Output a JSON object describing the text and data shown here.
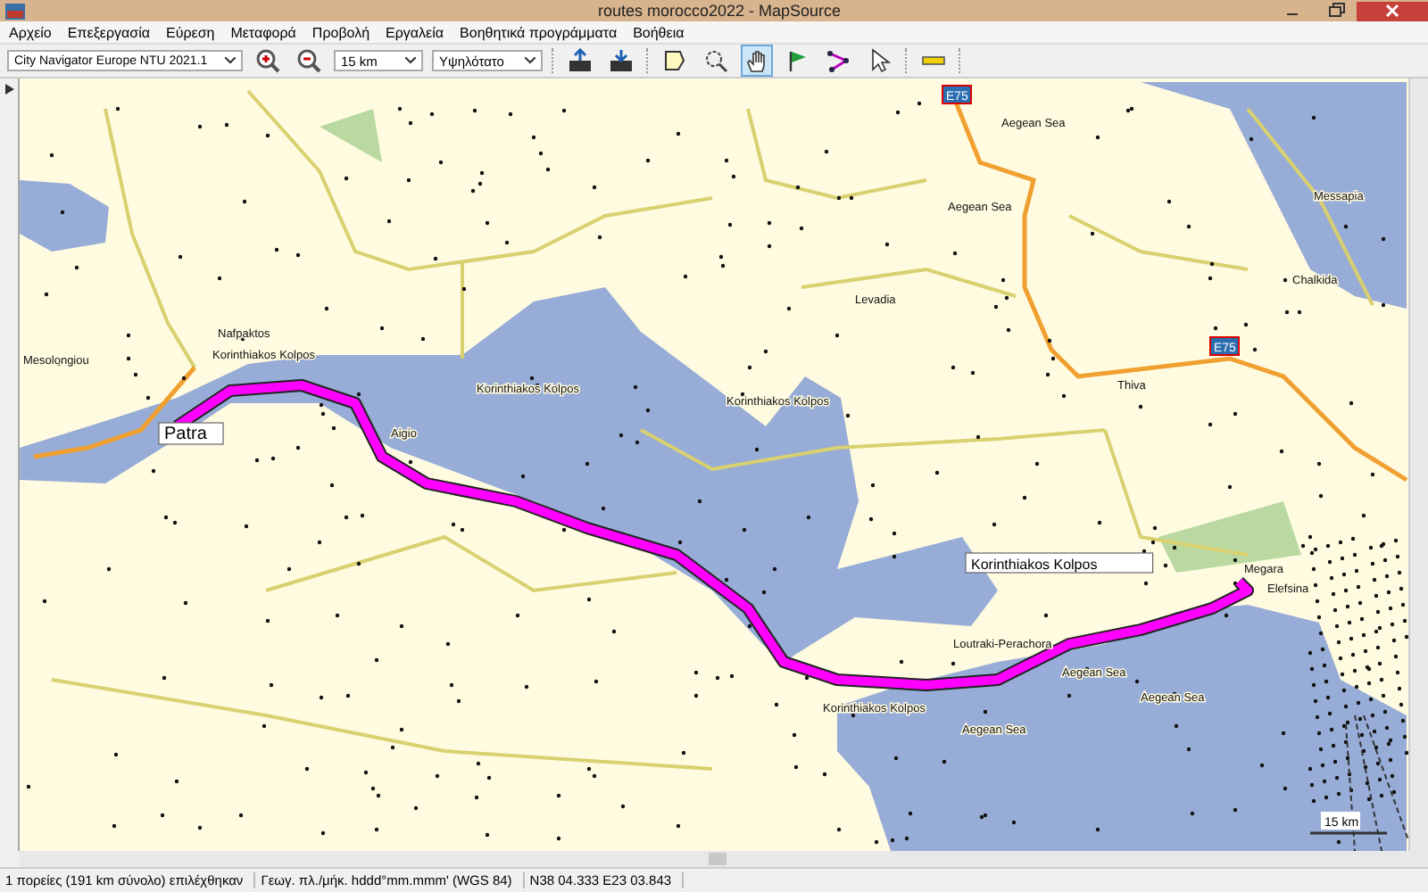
{
  "window": {
    "title": "routes morocco2022 - MapSource"
  },
  "menu": [
    "Αρχείο",
    "Επεξεργασία",
    "Εύρεση",
    "Μεταφορά",
    "Προβολή",
    "Εργαλεία",
    "Βοηθητικά προγράμματα",
    "Βοήθεια"
  ],
  "toolbar": {
    "map_select": "City Navigator Europe NTU 2021.1",
    "zoom_select": "15 km",
    "detail_select": "Υψηλότατο",
    "tools": [
      {
        "kind": "zoom-in",
        "selected": false
      },
      {
        "kind": "zoom-out",
        "selected": false
      },
      {
        "kind": "send",
        "selected": false
      },
      {
        "kind": "receive",
        "selected": false
      },
      {
        "kind": "select",
        "selected": false
      },
      {
        "kind": "zoom",
        "selected": false
      },
      {
        "kind": "hand",
        "selected": true
      },
      {
        "kind": "flag",
        "selected": false
      },
      {
        "kind": "route",
        "selected": false
      },
      {
        "kind": "pointer",
        "selected": false
      },
      {
        "kind": "ruler",
        "selected": false
      }
    ]
  },
  "map": {
    "labels": [
      {
        "text": "Patra",
        "kind": "boxed"
      },
      {
        "text": "Korinthiakos Kolpos",
        "kind": "plain"
      },
      {
        "text": "Korinthiakos Kolpos",
        "kind": "plain"
      },
      {
        "text": "Korinthiakos Kolpos",
        "kind": "plain"
      },
      {
        "text": "Korinthiakos Kolpos",
        "kind": "boxed"
      },
      {
        "text": "Korinthiakos Kolpos",
        "kind": "plain"
      },
      {
        "text": "Nafpaktos",
        "kind": "plain"
      },
      {
        "text": "Mesolongiou",
        "kind": "plain"
      },
      {
        "text": "Aigio",
        "kind": "plain"
      },
      {
        "text": "Levadia",
        "kind": "plain"
      },
      {
        "text": "Thiva",
        "kind": "plain"
      },
      {
        "text": "Aegean Sea",
        "kind": "plain"
      },
      {
        "text": "Aegean Sea",
        "kind": "plain"
      },
      {
        "text": "Aegean Sea",
        "kind": "plain"
      },
      {
        "text": "Aegean Sea",
        "kind": "plain"
      },
      {
        "text": "Aegean Sea",
        "kind": "plain"
      },
      {
        "text": "Messapia",
        "kind": "plain"
      },
      {
        "text": "Chalkida",
        "kind": "plain"
      },
      {
        "text": "Loutraki-Perachora",
        "kind": "plain"
      },
      {
        "text": "Megara",
        "kind": "plain"
      },
      {
        "text": "Elefsina",
        "kind": "plain"
      }
    ],
    "shields": [
      "E75",
      "E75"
    ],
    "scale": "15 km"
  },
  "status_bar": [
    "1 πορείες (191 km σύνολο) επιλέχθηκαν",
    "Γεωγ. πλ./μήκ. hddd°mm.mmm' (WGS 84)",
    "N38 04.333 E23 03.843"
  ]
}
